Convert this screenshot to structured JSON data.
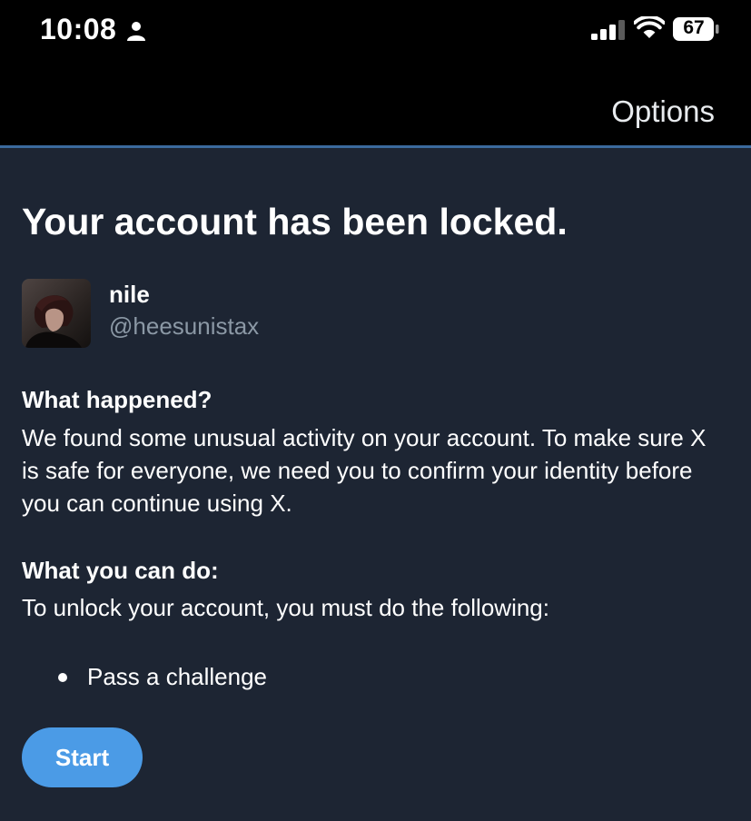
{
  "status_bar": {
    "time": "10:08",
    "battery_level": "67",
    "icons": [
      "person-icon",
      "cellular-signal-icon",
      "wifi-icon",
      "battery-icon"
    ]
  },
  "header": {
    "options_label": "Options"
  },
  "main": {
    "title": "Your account has been locked.",
    "user": {
      "name": "nile",
      "handle": "@heesunistax"
    },
    "what_happened": {
      "heading": "What happened?",
      "text": "We found some unusual activity on your account. To make sure X is safe for everyone, we need you to confirm your identity before you can continue using X."
    },
    "what_you_can_do": {
      "heading": "What you can do:",
      "text": "To unlock your account, you must do the following:",
      "steps": [
        "Pass a challenge"
      ]
    },
    "start_label": "Start"
  },
  "colors": {
    "background": "#1d2533",
    "header_background": "#000000",
    "divider": "#3b6a9d",
    "accent": "#4b9be6",
    "secondary_text": "#8b98a5"
  }
}
